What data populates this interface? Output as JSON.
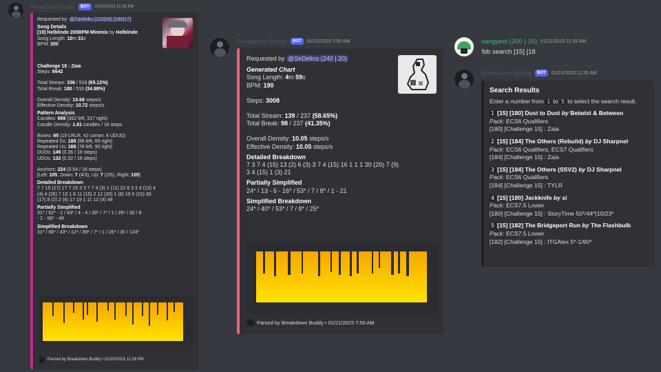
{
  "left": {
    "author": "Breakdown Buddy",
    "badge": "BOT",
    "timestamp": "01/20/2023 11:28 PM",
    "requested_prefix": "Requested by ",
    "requested_user": "@Zankoku (210|19) [190|17]",
    "song_details_title": "Song Details",
    "song_line_pre": "[18] Helblinde 200BPM Minimix",
    "song_line_by": " by ",
    "song_artist": "Helblinde",
    "length_label": "Song Length: ",
    "length_min": "10",
    "length_m": "m ",
    "length_sec": "31",
    "length_s": "s",
    "bpm_label": "BPM: ",
    "bpm": "200",
    "challenge": "Challenge 18 : Zaia",
    "steps_label": "Steps: ",
    "steps": "6642",
    "stream_label": "Total Stream: ",
    "stream_a": "336",
    "stream_mid": " / 516 ",
    "stream_pct": "(65.12%)",
    "break_label": "Total Break: ",
    "break_a": "180",
    "break_mid": " / 516 ",
    "break_pct": "(34.88%)",
    "overall_label": "Overall Density: ",
    "overall": "10.69",
    "overall_unit": " steps/s",
    "effective_label": "Effective Density: ",
    "effective": "10.72",
    "effective_unit": " steps/s",
    "pattern_title": "Pattern Analysis",
    "candles_label": "Candles: ",
    "candles": "669",
    "candles_rest": " (352 left, 317 right)",
    "candle_density_label": "Candle Density: ",
    "candle_density": "1.61",
    "candle_density_rest": " candles / 16 steps",
    "boxes_label": "Boxes: ",
    "boxes": "65",
    "boxes_rest": " (19 LRLR, 42 corner, 4 UDUD)",
    "rdx_label": "Repeated Dx: ",
    "rdx": "188",
    "rdx_rest": " (99 left, 89 right)",
    "rus_label": "Repeated Us: ",
    "rus": "168",
    "rus_rest": " (78 left, 90 right)",
    "duds_label": "DUDs: ",
    "duds": "149",
    "duds_rest": " (0.36 / 16 steps)",
    "udus_label": "UDUs: ",
    "udus": "132",
    "udus_rest": " (0.32 / 16 steps)",
    "anchors_label": "Anchors: ",
    "anchors": "224",
    "anchors_rest": " (0.54 / 16 steps)",
    "anchors_detail_pre": "[Left: ",
    "anchors_left": "105",
    "anchors_detail_mid": ", Down: ",
    "anchors_down": "7",
    "anchors_detail_rest": " (4/3), Up: ",
    "anchors_up": "7",
    "anchors_detail_rest2": " (2/5), Right: ",
    "anchors_right": "105",
    "anchors_detail_end": "]",
    "detailed_title": "Detailed Breakdown",
    "detailed_lines": [
      "7 7 15 (17) 17 7 15 3 3 7 7 4 (3) 1 (11) 22 8 3 3 3 (13) 4",
      "(4) 4 (26) 7 10 1 6 11 (15) 2 12 (20) 1 (8) 19 6 (10) 30",
      "(17) 8 (2) 2 (4) 17 19 1 11 12 (4) 48"
    ],
    "partial_title": "Partially Simplified",
    "partial_lines": [
      "31* / 62* - 1 / 43* / 4 - 4 / 39* / 7* / 1 / 26* / 30 / 8",
      "- 2 - 56* - 48"
    ],
    "simplified_title": "Simplified Breakdown",
    "simplified_line": "31* / 66* / 43* / 12* / 39* / 7* / 1 / 26* / 30 / 124*",
    "footer": "Parsed by Breakdown Buddy • 01/20/2023 11:28 PM",
    "accent": "#c02a8e"
  },
  "middle": {
    "author": "Breakdown Buddy",
    "badge": "BOT",
    "timestamp": "01/21/2023 7:50 AM",
    "requested_prefix": "Requested by ",
    "requested_user": "@SirDelins (240 | 20)",
    "generated_title": "Generated Chart",
    "length_label": "Song Length: ",
    "length_min": "4",
    "length_m": "m ",
    "length_sec": "59",
    "length_s": "s",
    "bpm_label": "BPM: ",
    "bpm": "190",
    "steps_label": "Steps: ",
    "steps": "3008",
    "stream_label": "Total Stream: ",
    "stream_a": "139",
    "stream_mid": " / 237 ",
    "stream_pct": "(58.65%)",
    "break_label": "Total Break: ",
    "break_a": "98",
    "break_mid": " / 237 ",
    "break_pct": "(41.35%)",
    "overall_label": "Overall Density: ",
    "overall": "10.05",
    "overall_unit": " steps/s",
    "effective_label": "Effective Density: ",
    "effective": "10.05",
    "effective_unit": " steps/s",
    "detailed_title": "Detailed Breakdown",
    "detailed_lines": [
      "7 3 7 4 (15) 13 (2) 6 (3) 3 7 4 (15) 16 1 1 1 30 (26) 7 (9)",
      "3 4 (15) 1 (3) 21"
    ],
    "partial_title": "Partially Simplified",
    "partial_line": "24* / 13 - 6 - 16* / 53* / 7 / 8* / 1 - 21",
    "simplified_title": "Simplified Breakdown",
    "simplified_line": "24* / 40* / 53* / 7 / 8* / 25*",
    "footer": "Parsed by Breakdown Buddy • 01/21/2023 7:50 AM",
    "accent": "#e6677a"
  },
  "user_msg": {
    "author": "sangyeol (200 | 16)",
    "timestamp": "01/21/2023 11:35 AM",
    "text": "!bb search [15] [18",
    "author_color": "#43b581"
  },
  "right": {
    "author": "Breakdown Buddy",
    "badge": "BOT",
    "timestamp": "01/21/2023 11:35 AM",
    "title": "Search Results",
    "instr_pre": "Enter a number from ",
    "instr_a": "1",
    "instr_mid": " to ",
    "instr_b": "5",
    "instr_post": " to select the search result.",
    "pack_label": "Pack:",
    "results": [
      {
        "n": "1",
        "title": "[15] [180] Dust to Dust",
        "by": "by",
        "artist": "Betwixt & Between",
        "pack": "ECS6 Qualifiers",
        "chart": "[180] [Challenge 15] : Zaia"
      },
      {
        "n": "2",
        "title": "[15] [184] The Others (Rebuild)",
        "by": "by",
        "artist": "DJ Sharpnel",
        "pack": "ECS6 Qualifiers, ECS7 Qualifiers",
        "chart": "[184] [Challenge 15] : Zaia"
      },
      {
        "n": "3",
        "title": "[15] [184] The Others (SSV2)",
        "by": "by",
        "artist": "DJ Sharpnel",
        "pack": "ECS6 Qualifiers",
        "chart": "[184] [Challenge 15] : TYLR"
      },
      {
        "n": "4",
        "title": "[15] [180] Jackknife",
        "by": "by",
        "artist": "xi",
        "pack": "ECS7.5 Lower",
        "chart": "[180] [Challenge 15] : StoryTime 50*/44*|10/23*"
      },
      {
        "n": "5",
        "title": "[15] [182] The Bridgeport Run",
        "by": "by",
        "artist": "The Flashbulb",
        "pack": "ECS7.5 Lower",
        "chart": "[182] [Challenge 15] : ITGAlex 5*-1/90*"
      }
    ]
  }
}
